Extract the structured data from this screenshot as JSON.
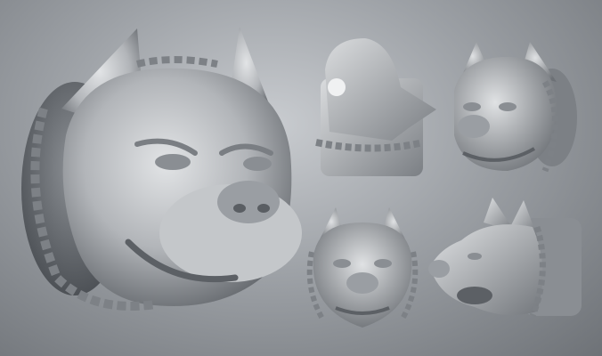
{
  "scene": {
    "views": [
      {
        "id": "main-three-quarter",
        "label": ""
      },
      {
        "id": "side-up-view",
        "label": ""
      },
      {
        "id": "top-right-three-quarter",
        "label": ""
      },
      {
        "id": "front-view",
        "label": ""
      },
      {
        "id": "side-profile-view",
        "label": ""
      }
    ],
    "colors": {
      "background_light": "#c9ccd0",
      "background_dark": "#6e7277",
      "clay_light": "#d9dbdd",
      "clay_mid": "#a9acb0",
      "clay_dark": "#5f6368"
    }
  }
}
